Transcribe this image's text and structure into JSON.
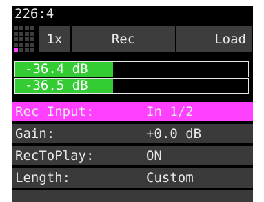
{
  "status": {
    "counter": "226:4"
  },
  "buttons": {
    "speed_label": "1x",
    "rec_label": "Rec",
    "load_label": "Load"
  },
  "grid_icon": {
    "name": "pattern-grid-icon",
    "active_cell": "bottom-left"
  },
  "meters": [
    {
      "label": "-36.4 dB",
      "level": 0.42
    },
    {
      "label": "-36.5 dB",
      "level": 0.42
    }
  ],
  "params": [
    {
      "label": "Rec Input:",
      "value": "In 1/2",
      "selected": true
    },
    {
      "label": "Gain:",
      "value": "+0.0 dB",
      "selected": false
    },
    {
      "label": "RecToPlay:",
      "value": "ON",
      "selected": false
    },
    {
      "label": "Length:",
      "value": "Custom",
      "selected": false
    },
    {
      "label": "",
      "value": "",
      "selected": false
    }
  ],
  "colors": {
    "accent": "#ff40ff",
    "meter_fill": "#33cc33",
    "button_bg": "#3d3d3d",
    "row_bg": "#3a3a3a",
    "text": "#e8e8e8",
    "background": "#000000"
  }
}
